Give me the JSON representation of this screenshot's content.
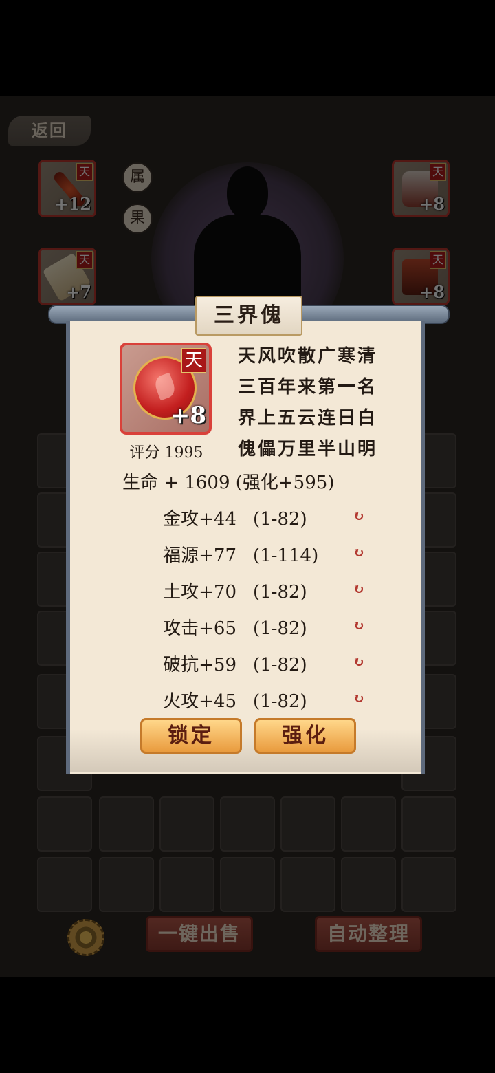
{
  "top_bar": {
    "back_label": "返回"
  },
  "equipment_left": [
    {
      "tier": "天",
      "level": "+12"
    },
    {
      "tier": "天",
      "level": "+7"
    }
  ],
  "equipment_right": [
    {
      "tier": "天",
      "level": "+8"
    },
    {
      "tier": "天",
      "level": "+8"
    }
  ],
  "side_buttons": {
    "attr": "属",
    "fruit": "果"
  },
  "bottom": {
    "sell_label": "一键出售",
    "sort_label": "自动整理"
  },
  "dialog": {
    "title": "三界傀",
    "item": {
      "tier": "天",
      "level": "+8",
      "score": "评分 1995"
    },
    "poem": [
      "天风吹散广寒清",
      "三百年来第一名",
      "界上五云连日白",
      "傀儡万里半山明"
    ],
    "main_stat": "生命 + 1609  (强化+595)",
    "stats": [
      {
        "name": "金攻+44",
        "range": "(1-82)"
      },
      {
        "name": "福源+77",
        "range": "(1-114)"
      },
      {
        "name": "土攻+70",
        "range": "(1-82)"
      },
      {
        "name": "攻击+65",
        "range": "(1-82)"
      },
      {
        "name": "破抗+59",
        "range": "(1-82)"
      },
      {
        "name": "火攻+45",
        "range": "(1-82)"
      }
    ],
    "lock_label": "锁定",
    "enhance_label": "强化"
  },
  "colors": {
    "accent": "#d9413a",
    "button": "#e99b3e"
  }
}
